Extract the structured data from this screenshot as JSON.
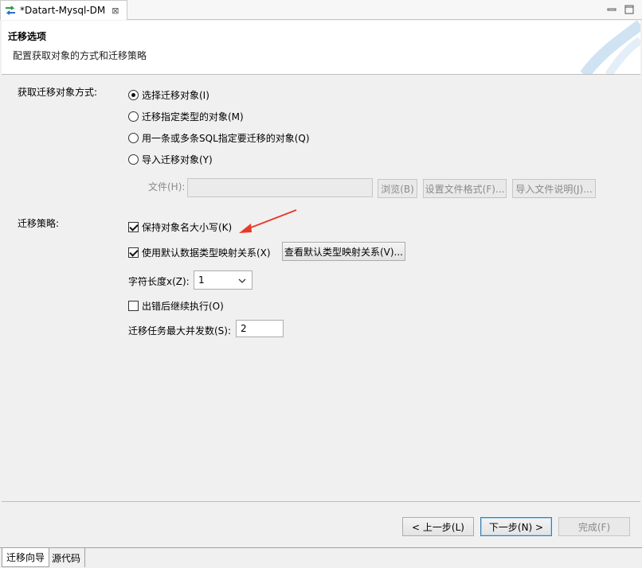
{
  "editor": {
    "tab_title": "*Datart-Mysql-DM",
    "close_glyph": "⊠"
  },
  "header": {
    "title": "迁移选项",
    "description": "配置获取对象的方式和迁移策略"
  },
  "fetch_mode": {
    "label": "获取迁移对象方式:",
    "options": [
      {
        "label": "选择迁移对象(I)",
        "checked": true
      },
      {
        "label": "迁移指定类型的对象(M)",
        "checked": false
      },
      {
        "label": "用一条或多条SQL指定要迁移的对象(Q)",
        "checked": false
      },
      {
        "label": "导入迁移对象(Y)",
        "checked": false
      }
    ],
    "file_label": "文件(H):",
    "file_value": "",
    "browse_button": "浏览(B)",
    "format_button": "设置文件格式(F)...",
    "import_help_button": "导入文件说明(J)..."
  },
  "strategy": {
    "label": "迁移策略:",
    "keep_case": {
      "label": "保持对象名大小写(K)",
      "checked": true
    },
    "default_mapping": {
      "label": "使用默认数据类型映射关系(X)",
      "checked": true
    },
    "view_mapping_button": "查看默认类型映射关系(V)...",
    "char_length_label": "字符长度x(Z):",
    "char_length_value": "1",
    "continue_on_error": {
      "label": "出错后继续执行(O)",
      "checked": false
    },
    "max_concurrency_label": "迁移任务最大并发数(S):",
    "max_concurrency_value": "2"
  },
  "footer": {
    "back_button": "< 上一步(L)",
    "next_button": "下一步(N) >",
    "finish_button": "完成(F)"
  },
  "bottom_tabs": [
    "迁移向导",
    "源代码"
  ],
  "colors": {
    "arrow": "#e8392a",
    "icon_green": "#2e9e4a",
    "icon_blue": "#2a6fc9",
    "banner_deco": "#cfe3f3"
  }
}
